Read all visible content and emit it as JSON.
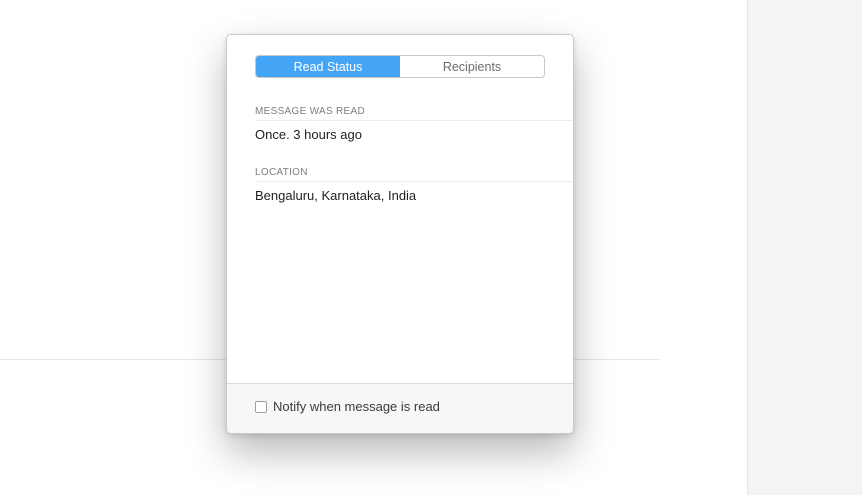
{
  "background": {
    "fragment_text": "."
  },
  "popover": {
    "tabs": [
      {
        "label": "Read Status",
        "active": true
      },
      {
        "label": "Recipients",
        "active": false
      }
    ],
    "read_section": {
      "heading": "MESSAGE WAS READ",
      "value": "Once. 3 hours ago"
    },
    "location_section": {
      "heading": "LOCATION",
      "value": "Bengaluru, Karnataka, India"
    },
    "footer": {
      "notify_label": "Notify when message is read",
      "notify_checked": false
    }
  },
  "colors": {
    "accent": "#44a5f6",
    "side_panel": "#f4f4f6"
  }
}
